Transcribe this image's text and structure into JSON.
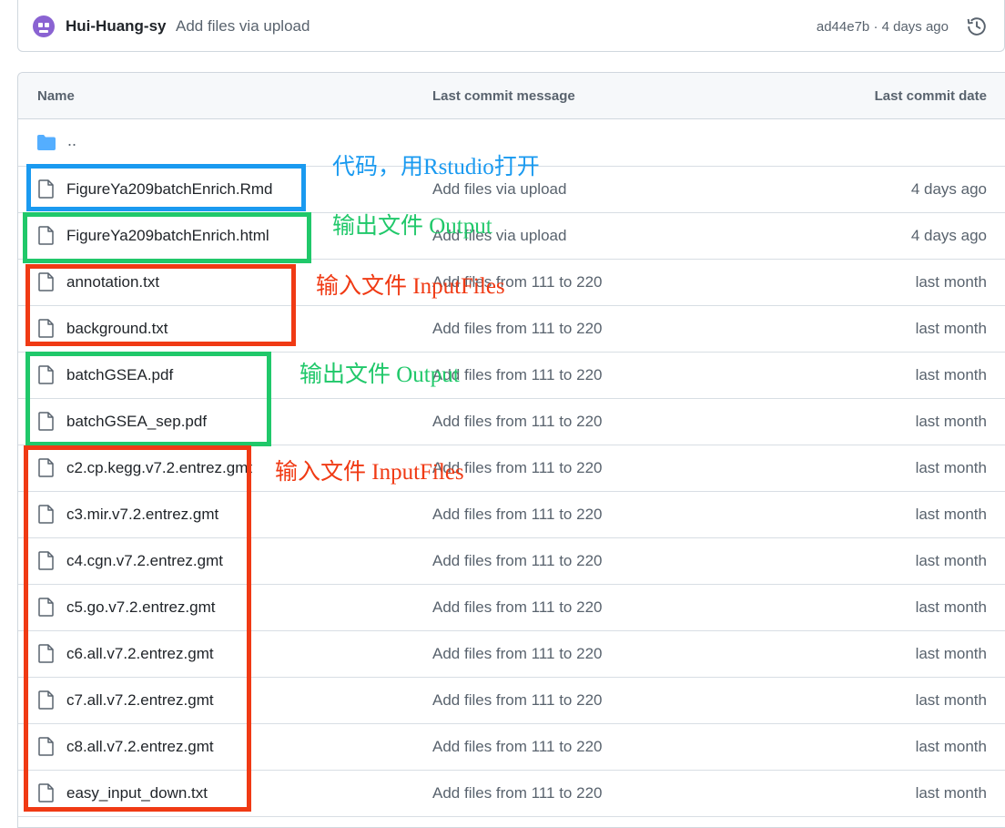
{
  "commit": {
    "author": "Hui-Huang-sy",
    "message": "Add files via upload",
    "meta": "ad44e7b · 4 days ago"
  },
  "table": {
    "headers": {
      "name": "Name",
      "message": "Last commit message",
      "date": "Last commit date"
    },
    "parent_label": "..",
    "rows": [
      {
        "name": "FigureYa209batchEnrich.Rmd",
        "message": "Add files via upload",
        "date": "4 days ago"
      },
      {
        "name": "FigureYa209batchEnrich.html",
        "message": "Add files via upload",
        "date": "4 days ago"
      },
      {
        "name": "annotation.txt",
        "message": "Add files from 111 to 220",
        "date": "last month"
      },
      {
        "name": "background.txt",
        "message": "Add files from 111 to 220",
        "date": "last month"
      },
      {
        "name": "batchGSEA.pdf",
        "message": "Add files from 111 to 220",
        "date": "last month"
      },
      {
        "name": "batchGSEA_sep.pdf",
        "message": "Add files from 111 to 220",
        "date": "last month"
      },
      {
        "name": "c2.cp.kegg.v7.2.entrez.gmt",
        "message": "Add files from 111 to 220",
        "date": "last month"
      },
      {
        "name": "c3.mir.v7.2.entrez.gmt",
        "message": "Add files from 111 to 220",
        "date": "last month"
      },
      {
        "name": "c4.cgn.v7.2.entrez.gmt",
        "message": "Add files from 111 to 220",
        "date": "last month"
      },
      {
        "name": "c5.go.v7.2.entrez.gmt",
        "message": "Add files from 111 to 220",
        "date": "last month"
      },
      {
        "name": "c6.all.v7.2.entrez.gmt",
        "message": "Add files from 111 to 220",
        "date": "last month"
      },
      {
        "name": "c7.all.v7.2.entrez.gmt",
        "message": "Add files from 111 to 220",
        "date": "last month"
      },
      {
        "name": "c8.all.v7.2.entrez.gmt",
        "message": "Add files from 111 to 220",
        "date": "last month"
      },
      {
        "name": "easy_input_down.txt",
        "message": "Add files from 111 to 220",
        "date": "last month"
      }
    ]
  },
  "annotations": {
    "code_note": "代码，用Rstudio打开",
    "output_note_1": "输出文件 Output",
    "input_note_1": "输入文件 InputFiles",
    "output_note_2": "输出文件 Output",
    "input_note_2": "输入文件 InputFiles"
  },
  "colors": {
    "blue": "#1a9af0",
    "green": "#20c86a",
    "red": "#f03a14",
    "folder": "#54aeff"
  }
}
